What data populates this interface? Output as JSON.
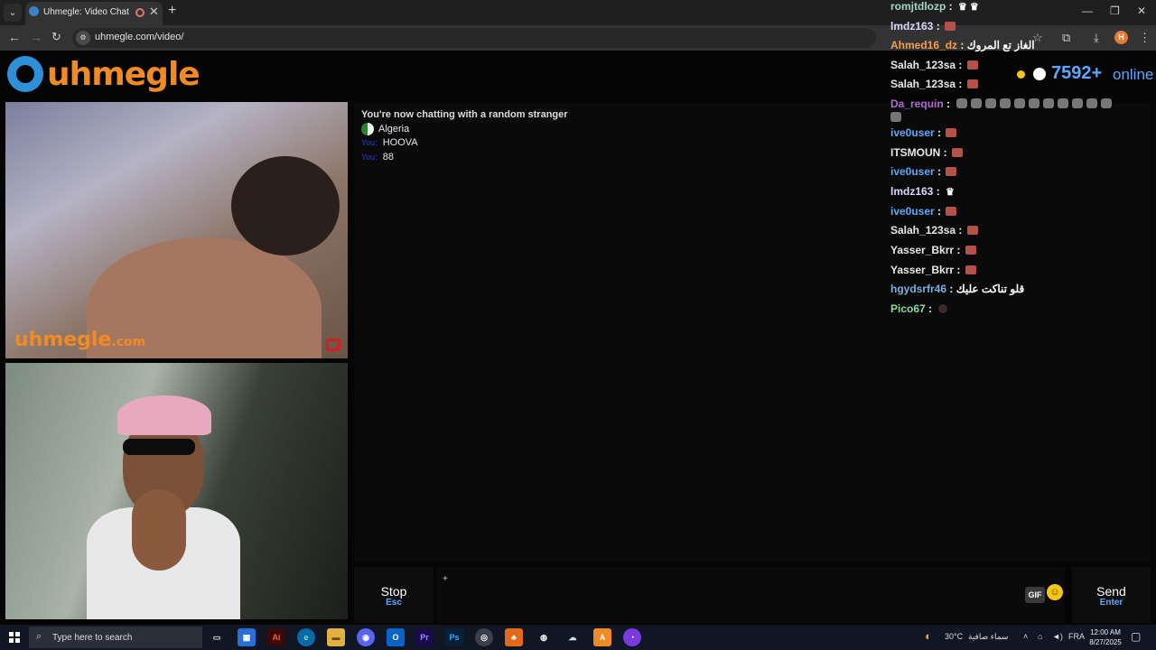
{
  "browser": {
    "tab_title": "Uhmegle: Video Chat | Ome",
    "url": "uhmegle.com/video/",
    "omni_icon": "site-info-icon"
  },
  "site": {
    "logo_text": "uhmegle",
    "online_count": "7592+",
    "online_label": "online"
  },
  "video": {
    "watermark_name": "uhmegle",
    "watermark_domain": ".com"
  },
  "chat": {
    "status": "You're now chatting with a random stranger",
    "country": "Algeria",
    "messages": [
      {
        "who": "You:",
        "text": "HOOVA"
      },
      {
        "who": "You:",
        "text": "88"
      }
    ]
  },
  "overlay_chat": [
    {
      "user": "romjtdlozp",
      "color": "#9fd8c8",
      "emotes": "crowns"
    },
    {
      "user": "lmdz163",
      "color": "#d8d8ff",
      "emotes": "red"
    },
    {
      "user": "Ahmed16_dz",
      "color": "#f0a050",
      "text": "الغاز تع المروك"
    },
    {
      "user": "Salah_123sa",
      "color": "#e8e8e8",
      "emotes": "red"
    },
    {
      "user": "Salah_123sa",
      "color": "#e8e8e8",
      "emotes": "red"
    },
    {
      "user": "Da_requin",
      "color": "#b06ad8",
      "emotes": "cats"
    },
    {
      "user": "ive0user",
      "color": "#5aa8ff",
      "emotes": "red"
    },
    {
      "user": "ITSMOUN",
      "color": "#e8e8e8",
      "emotes": "red"
    },
    {
      "user": "ive0user",
      "color": "#5aa8ff",
      "emotes": "red"
    },
    {
      "user": "lmdz163",
      "color": "#d8d8ff",
      "emotes": "crown"
    },
    {
      "user": "ive0user",
      "color": "#5aa8ff",
      "emotes": "red"
    },
    {
      "user": "Salah_123sa",
      "color": "#e8e8e8",
      "emotes": "red"
    },
    {
      "user": "Yasser_Bkrr",
      "color": "#e8e8e8",
      "emotes": "red"
    },
    {
      "user": "Yasser_Bkrr",
      "color": "#e8e8e8",
      "emotes": "red"
    },
    {
      "user": "hgydsrfr46",
      "color": "#7ab0e0",
      "text": "قلو تناكت عليك"
    },
    {
      "user": "Pico67",
      "color": "#8fd8a0",
      "emotes": "dot"
    }
  ],
  "controls": {
    "stop_label": "Stop",
    "stop_key": "Esc",
    "gif_label": "GIF",
    "send_label": "Send",
    "send_key": "Enter"
  },
  "taskbar": {
    "search_placeholder": "Type here to search",
    "weather_temp": "30°C",
    "weather_text": "سماء صافية",
    "lang": "FRA",
    "time": "12:00 AM",
    "date": "8/27/2025"
  },
  "colors": {
    "accent_orange": "#f08a24",
    "accent_blue": "#5aa8ff"
  }
}
